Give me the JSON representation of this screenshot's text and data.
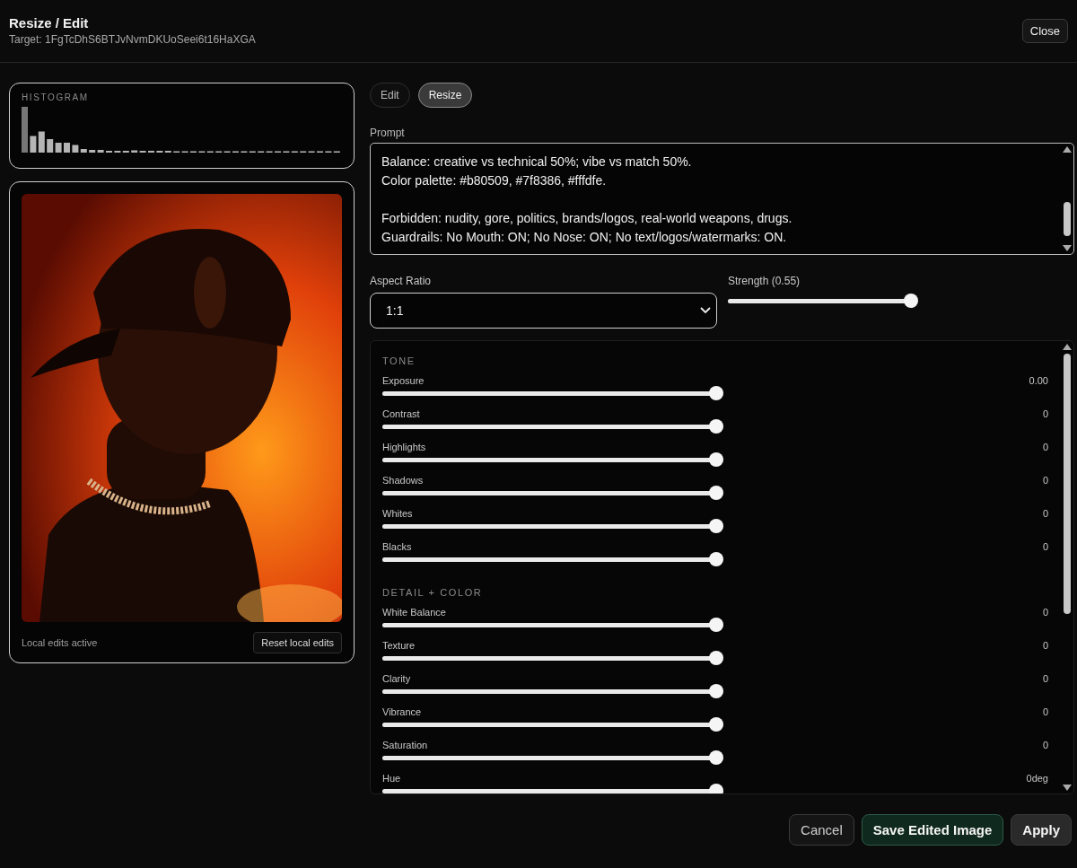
{
  "dialog": {
    "title": "Resize / Edit",
    "subtitle": "Target: 1FgTcDhS6BTJvNvmDKUoSeei6t16HaXGA",
    "close_label": "Close"
  },
  "histogram": {
    "title": "HISTOGRAM"
  },
  "preview": {
    "status": "Local edits active",
    "reset_label": "Reset local edits"
  },
  "tabs": [
    {
      "label": "Edit",
      "selected": false
    },
    {
      "label": "Resize",
      "selected": true
    }
  ],
  "prompt": {
    "label": "Prompt",
    "paragraphs": [
      [
        "Balance: creative vs technical 50%; vibe vs match 50%.",
        "Color palette: #b80509, #7f8386, #fffdfe."
      ],
      [
        "Forbidden: nudity, gore, politics, brands/logos, real-world weapons, drugs.",
        "Guardrails: No Mouth: ON; No Nose: ON; No text/logos/watermarks: ON."
      ]
    ]
  },
  "aspect_ratio": {
    "label": "Aspect Ratio",
    "value": "1:1"
  },
  "strength": {
    "label": "Strength (0.55)",
    "level": 0.97
  },
  "adjustments": [
    {
      "title": "TONE",
      "controls": [
        {
          "label": "Exposure",
          "value": "0.00",
          "level": 0.98
        },
        {
          "label": "Contrast",
          "value": "0",
          "level": 0.98
        },
        {
          "label": "Highlights",
          "value": "0",
          "level": 0.98
        },
        {
          "label": "Shadows",
          "value": "0",
          "level": 0.98
        },
        {
          "label": "Whites",
          "value": "0",
          "level": 0.98
        },
        {
          "label": "Blacks",
          "value": "0",
          "level": 0.98
        }
      ]
    },
    {
      "title": "DETAIL + COLOR",
      "controls": [
        {
          "label": "White Balance",
          "value": "0",
          "level": 0.98
        },
        {
          "label": "Texture",
          "value": "0",
          "level": 0.98
        },
        {
          "label": "Clarity",
          "value": "0",
          "level": 0.98
        },
        {
          "label": "Vibrance",
          "value": "0",
          "level": 0.98
        },
        {
          "label": "Saturation",
          "value": "0",
          "level": 0.98
        },
        {
          "label": "Hue",
          "value": "0deg",
          "level": 0.98
        }
      ]
    }
  ],
  "footer": {
    "cancel": "Cancel",
    "save": "Save Edited Image",
    "apply": "Apply"
  }
}
